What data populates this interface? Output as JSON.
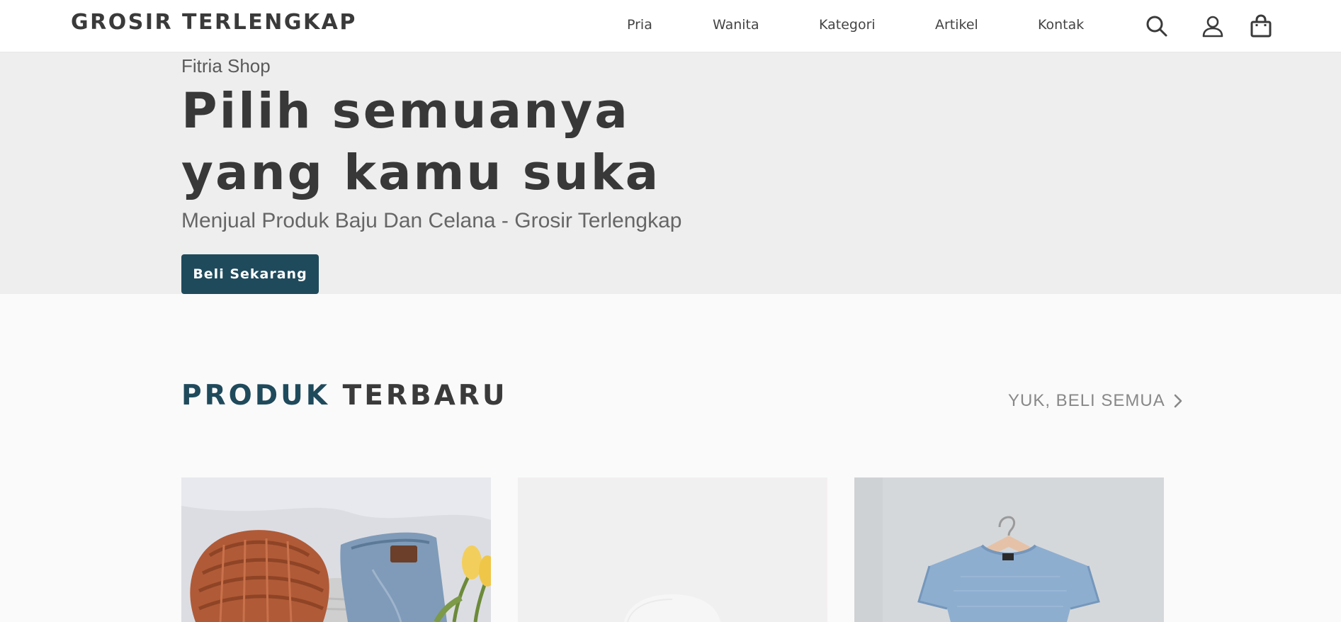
{
  "header": {
    "logo": "GROSIR TERLENGKAP",
    "nav": [
      "Pria",
      "Wanita",
      "Kategori",
      "Artikel",
      "Kontak"
    ],
    "icons": [
      "search-icon",
      "user-icon",
      "shopping-bag-icon"
    ]
  },
  "hero": {
    "shop_name": "Fitria Shop",
    "title_line1": "Pilih semuanya",
    "title_line2": "yang kamu suka",
    "subtitle": "Menjual Produk Baju Dan Celana - Grosir Terlengkap",
    "cta_label": "Beli Sekarang"
  },
  "products": {
    "title_part1": "PRODUK",
    "title_part2": "TERBARU",
    "see_all_label": "YUK, BELI SEMUA",
    "items": [
      "knit-beanie-and-jeans",
      "white-garment",
      "blue-tshirt-on-hanger"
    ]
  },
  "colors": {
    "accent": "#1f4a5c",
    "hero_bg": "#eeeeee",
    "page_bg": "#fafafa",
    "text_dark": "#3a3a3a"
  }
}
